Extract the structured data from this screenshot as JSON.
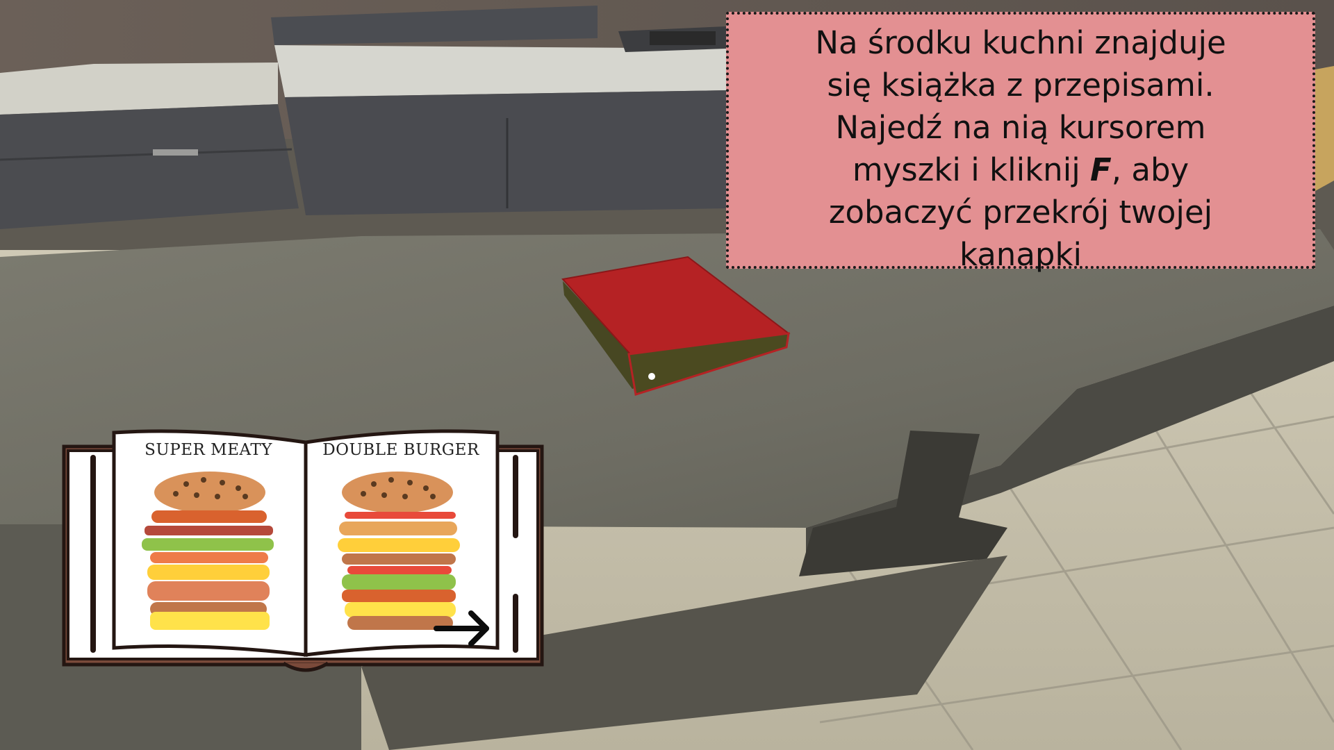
{
  "hint": {
    "line1": "Na środku kuchni znajduje",
    "line2": "się książka z przepisami.",
    "line3": "Najedź na nią kursorem",
    "line4_before": "myszki i kliknij ",
    "line4_key": "F",
    "line4_after": ", aby",
    "line5": "zobaczyć przekrój twojej",
    "line6": "kanapki"
  },
  "recipe_book": {
    "left_page_title": "SUPER MEATY",
    "right_page_title": "DOUBLE BURGER",
    "next_arrow_icon": "arrow-right-icon"
  },
  "colors": {
    "hint_background": "#e39092",
    "book_cover": "#b52224",
    "book_frame": "#7a4a3a"
  }
}
